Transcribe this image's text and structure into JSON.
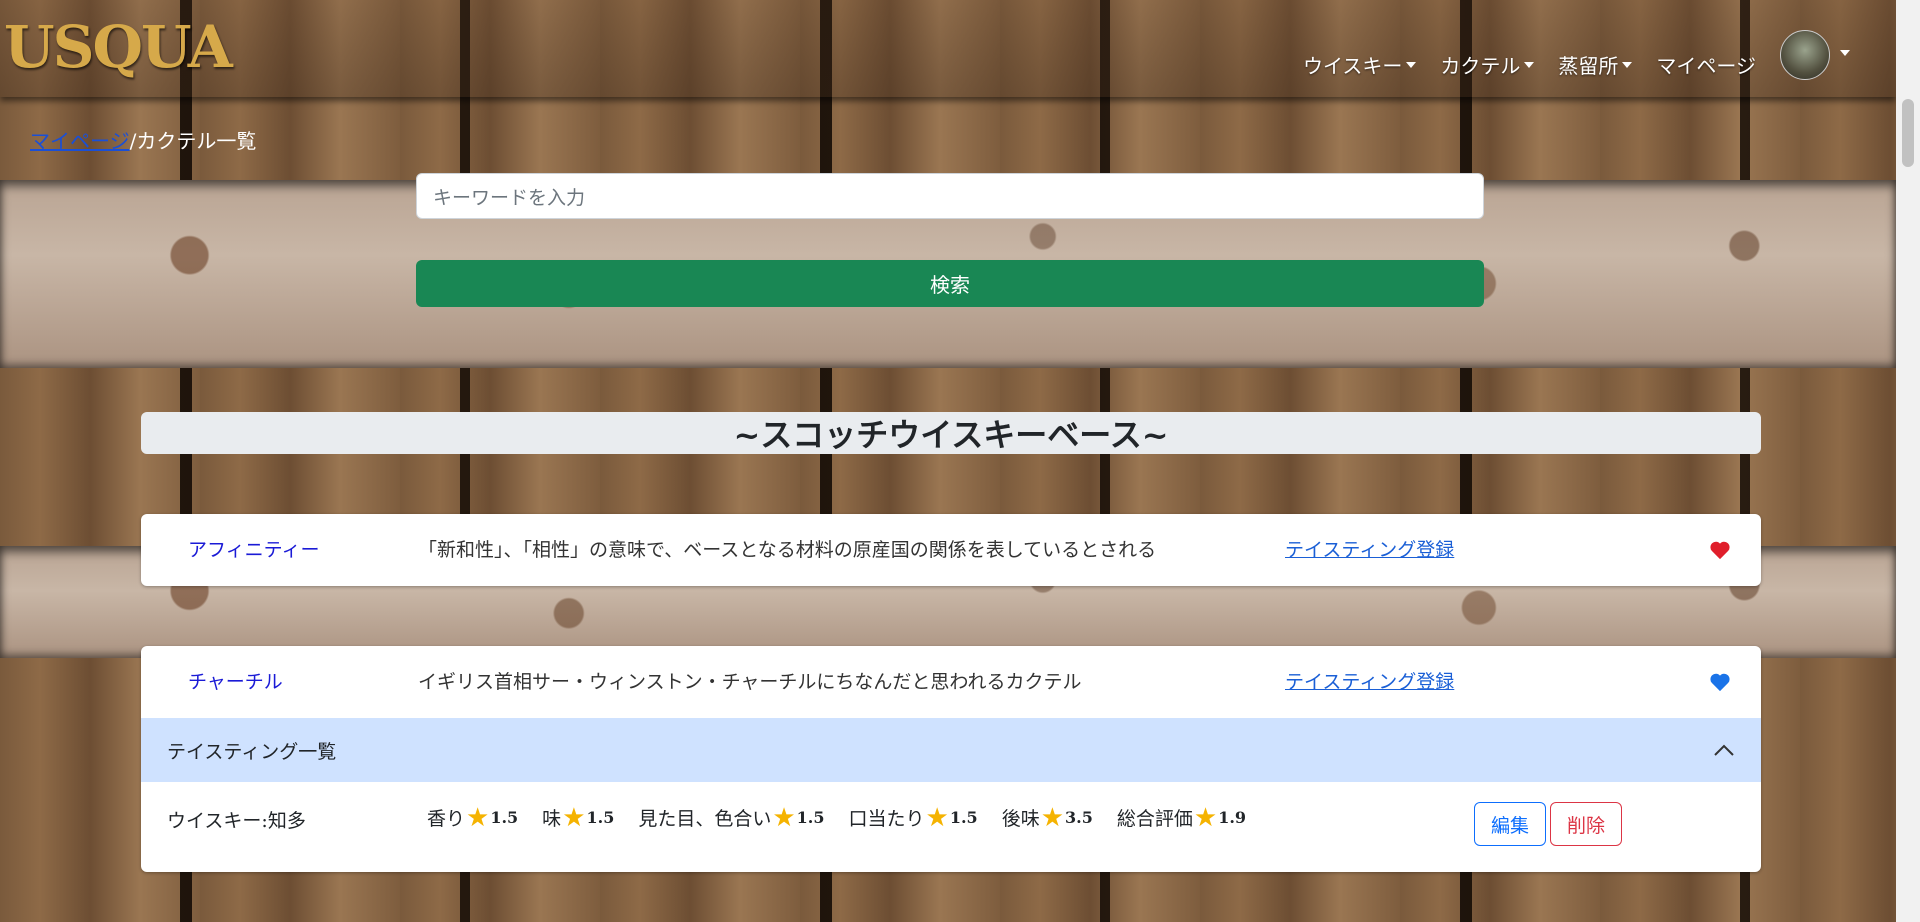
{
  "header": {
    "logo": "USQUA",
    "nav": [
      {
        "label": "ウイスキー",
        "dropdown": true
      },
      {
        "label": "カクテル",
        "dropdown": true
      },
      {
        "label": "蒸留所",
        "dropdown": true
      },
      {
        "label": "マイページ",
        "dropdown": false
      }
    ]
  },
  "breadcrumb": {
    "link": "マイページ",
    "separator": "/",
    "current": "カクテル一覧"
  },
  "search": {
    "placeholder": "キーワードを入力",
    "button_label": "検索"
  },
  "section_title": "~スコッチウイスキーベース~",
  "cocktails": [
    {
      "name": "アフィニティー",
      "description": "「新和性」、「相性」の意味で、ベースとなる材料の原産国の関係を表しているとされる",
      "tasting_link": "テイスティング登録",
      "favorite_color": "#e01e2b"
    },
    {
      "name": "チャーチル",
      "description": "イギリス首相サー・ウィンストン・チャーチルにちなんだと思われるカクテル",
      "tasting_link": "テイスティング登録",
      "favorite_color": "#1a73e8"
    }
  ],
  "tasting_panel": {
    "header": "テイスティング一覧",
    "entry": {
      "whisky": "ウイスキー:知多",
      "ratings": [
        {
          "label": "香り",
          "value": "1.5"
        },
        {
          "label": "味",
          "value": "1.5"
        },
        {
          "label": "見た目、色合い",
          "value": "1.5"
        },
        {
          "label": "口当たり",
          "value": "1.5"
        },
        {
          "label": "後味",
          "value": "3.5"
        },
        {
          "label": "総合評価",
          "value": "1.9"
        }
      ],
      "edit_label": "編集",
      "delete_label": "削除"
    }
  }
}
